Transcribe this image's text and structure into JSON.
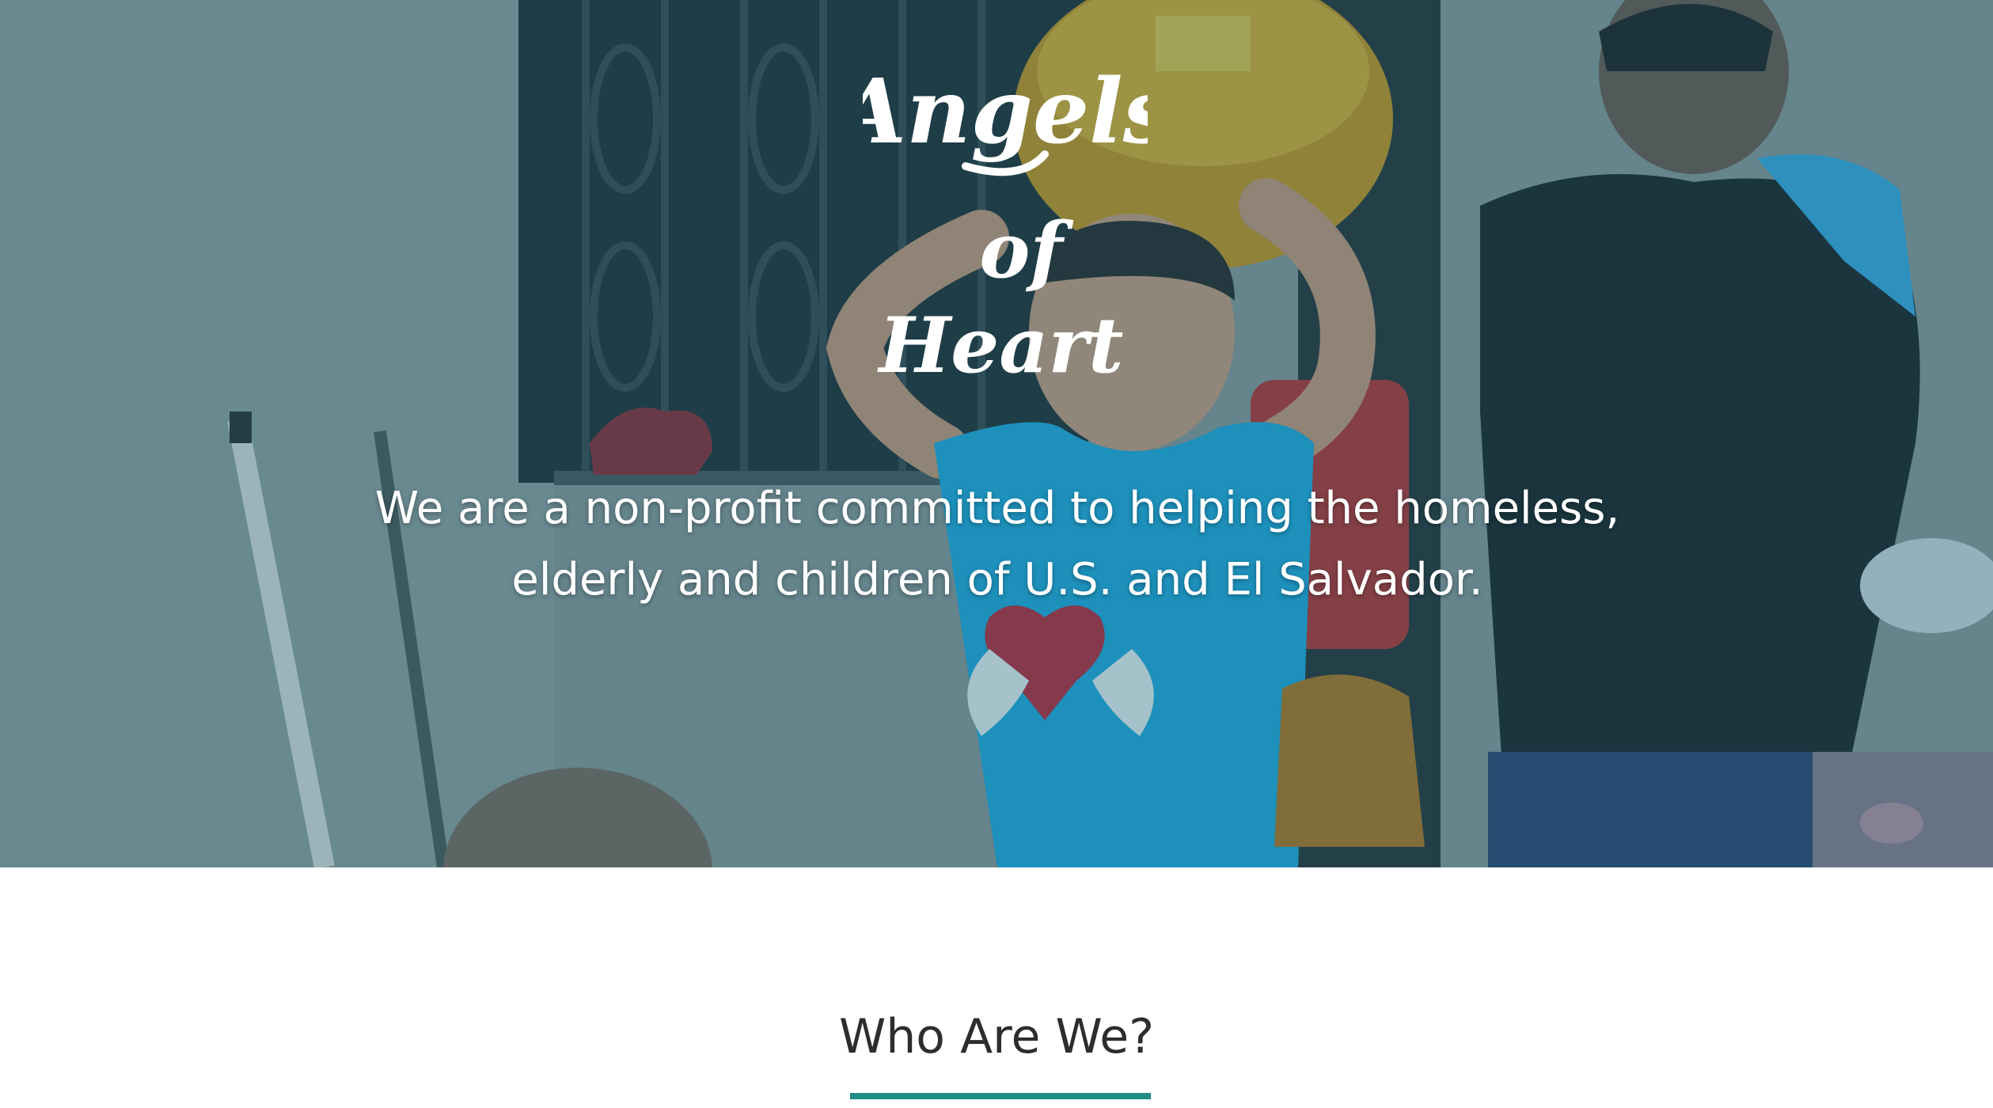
{
  "hero": {
    "background_image": "boy-carrying-gift-basket-photo",
    "overlay_color": "#1f6f8b",
    "logo": {
      "line1": "Angels",
      "line2": "of",
      "line3": "Heart"
    },
    "tagline": {
      "line1": "We are a non-profit committed to helping the homeless,",
      "line2": "elderly and children of U.S. and El Salvador."
    }
  },
  "section": {
    "title": "Who Are We?",
    "accent_color": "#1f8c86"
  }
}
